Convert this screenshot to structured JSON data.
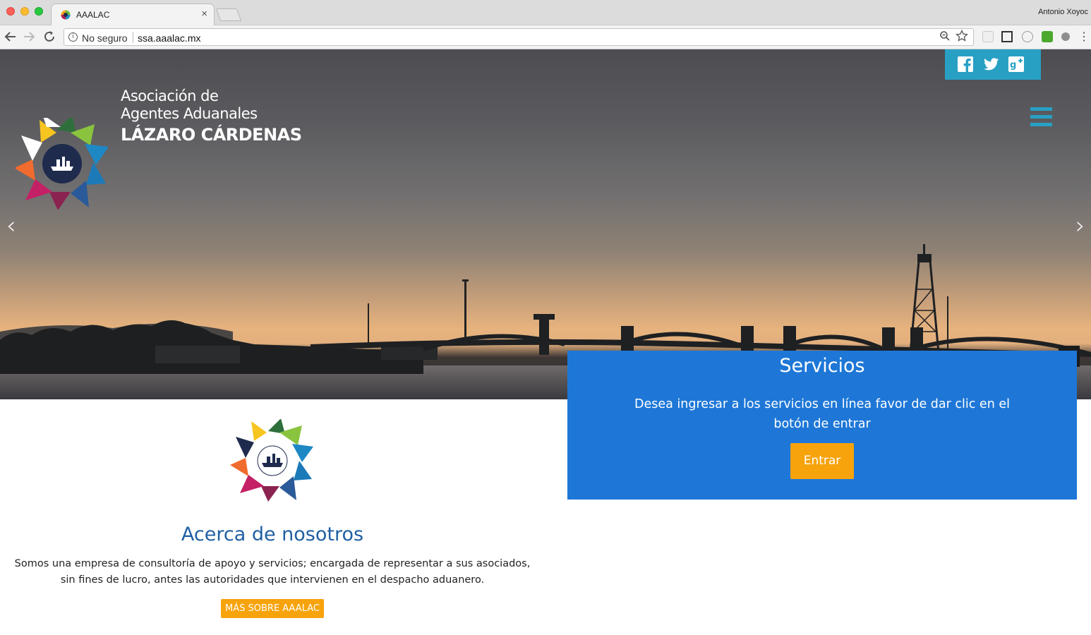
{
  "browser": {
    "tab_title": "AAALAC",
    "tab_close": "×",
    "profile_name": "Antonio Xoyoc",
    "security_label": "No seguro",
    "url": "ssa.aaalac.mx"
  },
  "header": {
    "logo_line1": "Asociación de",
    "logo_line2": "Agentes Aduanales",
    "logo_line3": "LÁZARO CÁRDENAS",
    "social_icons": [
      "facebook-icon",
      "twitter-icon",
      "google-plus-icon"
    ],
    "accent_color": "#28a0c4"
  },
  "carousel": {
    "prev": "‹",
    "next": "›"
  },
  "services": {
    "title": "Servicios",
    "description": "Desea ingresar a los servicios en línea favor de dar clic en el botón de entrar",
    "button_label": "Entrar",
    "panel_color": "#1e77d7",
    "button_color": "#f7a30c"
  },
  "about": {
    "title": "Acerca de nosotros",
    "description": "Somos una empresa de consultoría de apoyo y servicios; encargada de representar a sus asociados, sin fines de lucro, antes las autoridades que intervienen en el despacho aduanero.",
    "button_label": "MÁS SOBRE AAALAC",
    "title_color": "#1f5fa3"
  }
}
